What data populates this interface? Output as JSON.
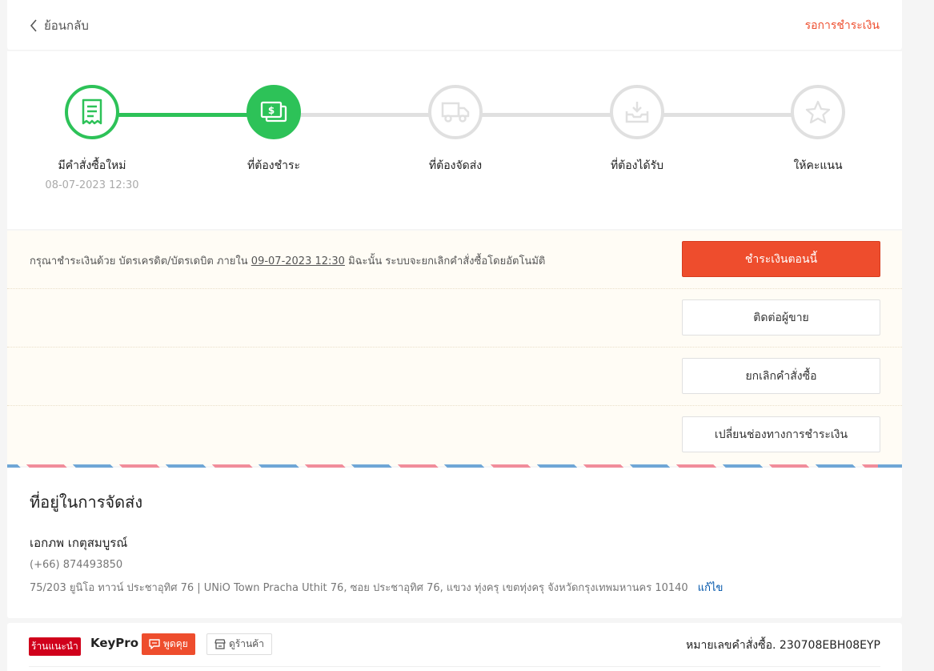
{
  "header": {
    "back_label": "ย้อนกลับ",
    "status": "รอการชำระเงิน"
  },
  "tracker": {
    "steps": [
      {
        "label": "มีคำสั่งซื้อใหม่",
        "time": "08-07-2023 12:30",
        "state": "done",
        "icon": "receipt-icon"
      },
      {
        "label": "ที่ต้องชำระ",
        "time": "",
        "state": "active",
        "icon": "money-icon"
      },
      {
        "label": "ที่ต้องจัดส่ง",
        "time": "",
        "state": "pending",
        "icon": "truck-icon"
      },
      {
        "label": "ที่ต้องได้รับ",
        "time": "",
        "state": "pending",
        "icon": "inbox-download-icon"
      },
      {
        "label": "ให้คะแนน",
        "time": "",
        "state": "pending",
        "icon": "star-icon"
      }
    ]
  },
  "payment_notice": {
    "prefix": "กรุณาชำระเงินด้วย บัตรเครดิต/บัตรเดบิต ภายใน",
    "deadline": "09-07-2023 12:30",
    "suffix": "มิฉะนั้น ระบบจะยกเลิกคำสั่งซื้อโดยอัตโนมัติ"
  },
  "actions": {
    "pay_now": "ชำระเงินตอนนี้",
    "contact_seller": "ติดต่อผู้ขาย",
    "cancel_order": "ยกเลิกคำสั่งซื้อ",
    "change_payment": "เปลี่ยนช่องทางการชำระเงิน"
  },
  "address": {
    "title": "ที่อยู่ในการจัดส่ง",
    "name": "เอกภพ เกตุสมบูรณ์",
    "phone": "(+66) 874493850",
    "line": "75/203 ยูนิโอ ทาวน์ ประชาอุทิศ 76 | UNiO Town Pracha Uthit 76, ซอย ประชาอุทิศ 76, แขวง ทุ่งครุ เขตทุ่งครุ จังหวัดกรุงเทพมหานคร 10140",
    "edit": "แก้ไข"
  },
  "shop": {
    "badge": "ร้านแนะนำ",
    "name": "KeyPro",
    "chat": "พูดคุย",
    "view_shop": "ดูร้านค้า",
    "order_number": "หมายเลขคำสั่งซื้อ. 230708EBH08EYP"
  },
  "colors": {
    "accent": "#ee4d2d",
    "progress": "#2dc258",
    "inactive": "#e0e0e0",
    "link": "#0055aa"
  }
}
